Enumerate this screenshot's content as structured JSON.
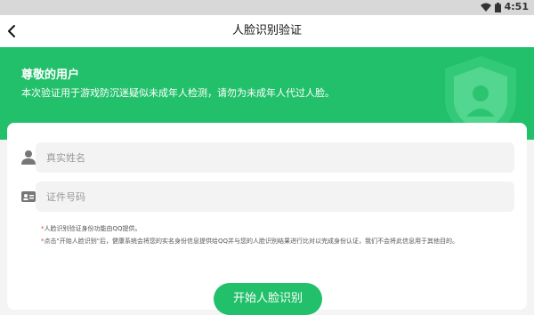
{
  "status_bar": {
    "time": "4:51",
    "icons": [
      "wifi-icon",
      "battery-icon"
    ]
  },
  "nav": {
    "title": "人脸识别验证",
    "back_icon": "back-arrow-icon"
  },
  "hero": {
    "title": "尊敬的用户",
    "description": "本次验证用于游戏防沉迷疑似未成年人检测，请勿为未成年人代过人脸。",
    "background_color": "#22c06a",
    "decoration_icon": "shield-user-icon"
  },
  "form": {
    "name_field": {
      "placeholder": "真实姓名",
      "value": "",
      "icon": "person-icon"
    },
    "id_field": {
      "placeholder": "证件号码",
      "value": "",
      "icon": "id-card-icon"
    }
  },
  "notes": {
    "star": "*",
    "line1": "人脸识别验证身份功能由QQ提供。",
    "line2": "点击\"开始人脸识别\"后，健康系统会将您的实名身份信息提供给QQ并与您的人脸识别结果进行比对以完成身份认证，我们不会将此信息用于其他目的。"
  },
  "actions": {
    "start_label": "开始人脸识别"
  },
  "colors": {
    "accent": "#22c06a",
    "card_bg": "#ffffff",
    "field_bg": "#f3f3f3"
  }
}
